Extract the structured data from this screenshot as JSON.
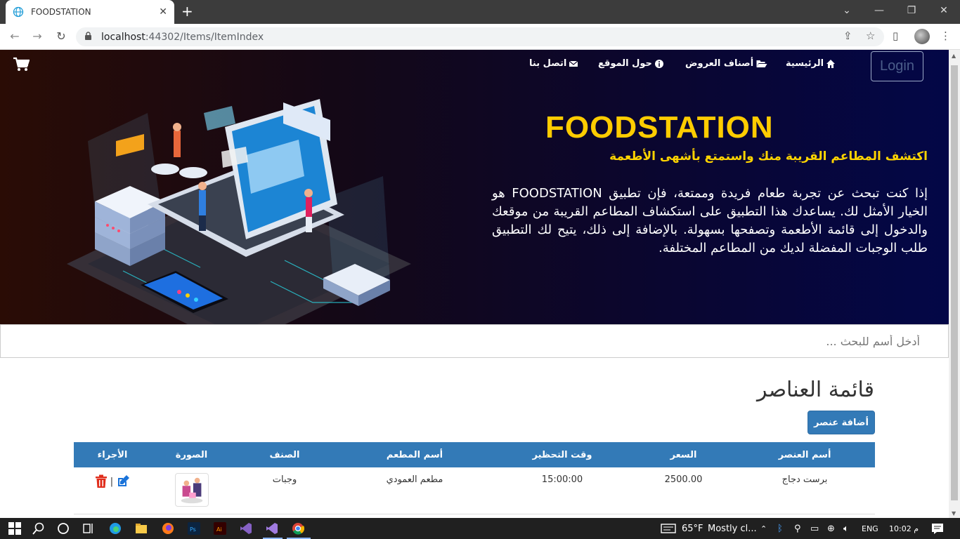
{
  "browser": {
    "tab_title": "FOODSTATION",
    "new_tab": "+",
    "address_host": "localhost",
    "address_path": ":44302/Items/ItemIndex"
  },
  "nav": {
    "home": "الرئيسية",
    "categories": "أصناف العروض",
    "about": "حول الموقع",
    "contact": "اتصل بنا",
    "login": "Login"
  },
  "hero": {
    "brand": "FOODSTATION",
    "tagline": "اكتشف المطاعم القريبة منك واستمتع بأشهى الأطعمة",
    "description": "إذا كنت تبحث عن تجربة طعام فريدة وممتعة، فإن تطبيق FOODSTATION هو الخيار الأمثل لك. يساعدك هذا التطبيق على استكشاف المطاعم القريبة من موقعك والدخول إلى قائمة الأطعمة وتصفحها بسهولة. بالإضافة إلى ذلك، يتيح لك التطبيق طلب الوجبات المفضلة لديك من المطاعم المختلفة."
  },
  "search": {
    "placeholder": "أدخل أسم للبحث ..."
  },
  "items": {
    "heading": "قائمة العناصر",
    "add_button": "أضافة عنصر",
    "columns": [
      "أسم العنصر",
      "السعر",
      "وقت التحظير",
      "أسم المطعم",
      "الصنف",
      "الصورة",
      "الأجراء"
    ],
    "rows": [
      {
        "name": "برست دجاج",
        "price": "2500.00",
        "prep_time": "15:00:00",
        "restaurant": "مطعم العمودي",
        "category": "وجبات",
        "separator": "|"
      }
    ]
  },
  "taskbar": {
    "weather": "65°F",
    "weather_desc": "Mostly cl...",
    "lang": "ENG",
    "time": "10:02 م"
  },
  "colors": {
    "brand": "#ffcc00",
    "primary": "#337ab7",
    "delete": "#e02d1b",
    "edit": "#1a73d9"
  }
}
